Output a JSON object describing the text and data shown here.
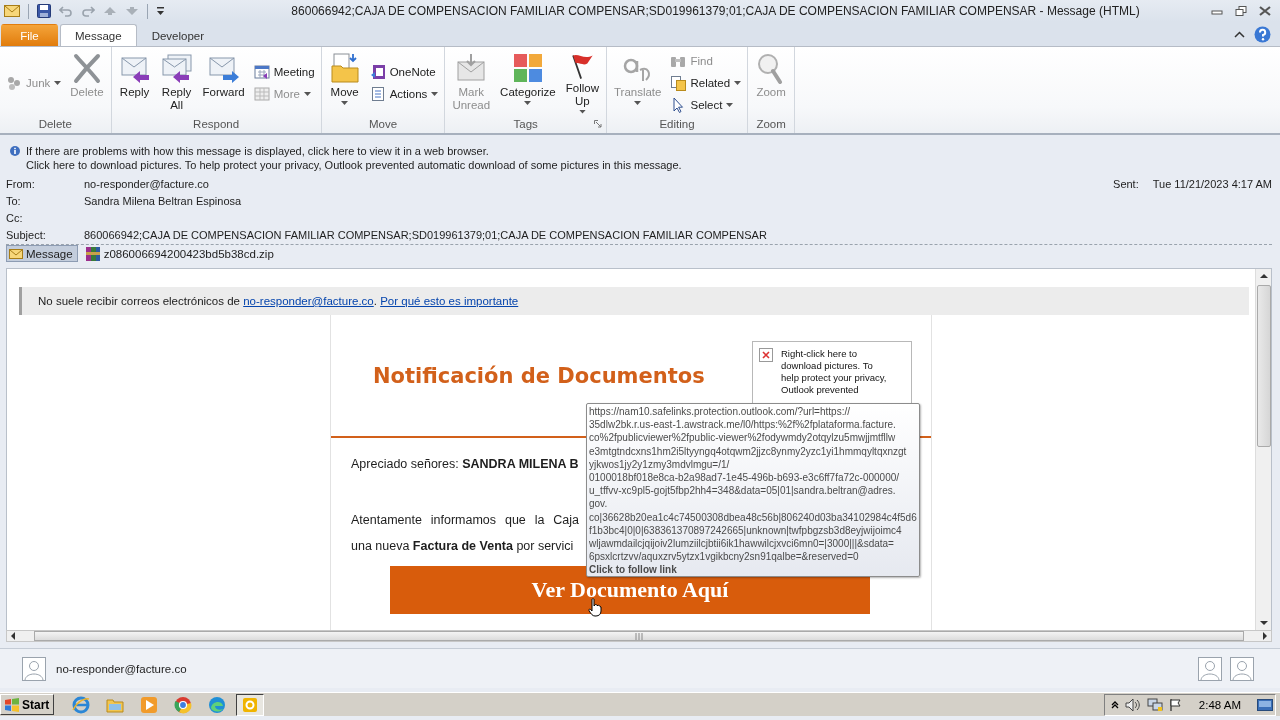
{
  "window": {
    "title": "860066942;CAJA DE COMPENSACION FAMILIAR COMPENSAR;SD019961379;01;CAJA DE COMPENSACION FAMILIAR COMPENSAR - Message (HTML)"
  },
  "tabs": [
    {
      "label": "File",
      "kind": "file",
      "selected": false
    },
    {
      "label": "Message",
      "kind": "tab",
      "selected": true
    },
    {
      "label": "Developer",
      "kind": "tab",
      "selected": false
    }
  ],
  "ribbon": {
    "groups": [
      {
        "label": "Delete",
        "columns": [
          [
            {
              "label": "Junk",
              "kind": "small",
              "disabled": true,
              "dropdown": true
            }
          ],
          [
            {
              "label": "Delete",
              "kind": "large",
              "disabled": true
            }
          ]
        ]
      },
      {
        "label": "Respond",
        "columns": [
          [
            {
              "label": "Reply",
              "kind": "large",
              "disabled": false
            }
          ],
          [
            {
              "label": "Reply All",
              "kind": "large",
              "disabled": false
            }
          ],
          [
            {
              "label": "Forward",
              "kind": "large",
              "disabled": false
            }
          ],
          [
            {
              "label": "Meeting",
              "kind": "small",
              "disabled": false
            },
            {
              "label": "More",
              "kind": "small",
              "disabled": true,
              "dropdown": true
            }
          ]
        ]
      },
      {
        "label": "Move",
        "columns": [
          [
            {
              "label": "Move",
              "kind": "large",
              "disabled": false,
              "dropdown": true
            }
          ],
          [
            {
              "label": "OneNote",
              "kind": "small",
              "disabled": false
            },
            {
              "label": "Actions",
              "kind": "small",
              "disabled": false,
              "dropdown": true
            }
          ]
        ]
      },
      {
        "label": "Tags",
        "launcher": true,
        "columns": [
          [
            {
              "label": "Mark Unread",
              "kind": "large",
              "disabled": true
            }
          ],
          [
            {
              "label": "Categorize",
              "kind": "large",
              "disabled": false,
              "dropdown": true
            }
          ],
          [
            {
              "label": "Follow Up",
              "kind": "large",
              "disabled": false,
              "dropdown": true
            }
          ]
        ]
      },
      {
        "label": "Editing",
        "columns": [
          [
            {
              "label": "Translate",
              "kind": "large",
              "disabled": true,
              "dropdown": true
            }
          ],
          [
            {
              "label": "Find",
              "kind": "small",
              "disabled": true
            },
            {
              "label": "Related",
              "kind": "small",
              "disabled": false,
              "dropdown": true
            },
            {
              "label": "Select",
              "kind": "small",
              "disabled": false,
              "dropdown": true
            }
          ]
        ]
      },
      {
        "label": "Zoom",
        "columns": [
          [
            {
              "label": "Zoom",
              "kind": "large",
              "disabled": true
            }
          ]
        ]
      }
    ]
  },
  "info_bar": [
    "If there are problems with how this message is displayed, click here to view it in a web browser.",
    "Click here to download pictures. To help protect your privacy, Outlook prevented automatic download of some pictures in this message."
  ],
  "headers": [
    {
      "label": "From:",
      "value": "no-responder@facture.co"
    },
    {
      "label": "To:",
      "value": "Sandra Milena Beltran Espinosa"
    },
    {
      "label": "Cc:"
    },
    {
      "label": "Subject:",
      "value": "860066942;CAJA DE COMPENSACION FAMILIAR COMPENSAR;SD019961379;01;CAJA DE COMPENSACION FAMILIAR COMPENSAR"
    }
  ],
  "sent": {
    "label": "Sent:",
    "value": "Tue 11/21/2023 4:17 AM"
  },
  "attachments": [
    {
      "label": "Message",
      "kind": "message",
      "selected": true
    },
    {
      "label": "z086006694200423bd5b38cd.zip",
      "kind": "zip",
      "selected": false
    }
  ],
  "banner": {
    "text": "No suele recibir correos electrónicos de",
    "sender_link": "no-responder@facture.co",
    "separator": ".",
    "info_link": "Por qué esto es importante"
  },
  "email": {
    "title": "Notificación de Documentos",
    "image_placeholder": [
      "Right-click here to",
      "download pictures.  To",
      "help protect your privacy,",
      "Outlook prevented"
    ],
    "greeting": "Apreciado señores: **SANDRA MILENA B**",
    "paragraph": [
      "Atentamente informamos que la Caja",
      "una nueva **Factura de Venta** por servici"
    ],
    "button": "Ver Documento Aquí"
  },
  "tooltip": {
    "lines": [
      "https://nam10.safelinks.protection.outlook.com/?url=https://",
      "35dlw2bk.r.us-east-1.awstrack.me/l0/https:%2f%2fplataforma.facture.",
      "co%2fpublicviewer%2fpublic-viewer%2fodywmdy2otqylzu5mwjjmtfllw",
      "e3mtgtndcxns1hm2i5ltyyngq4otqwm2jjzc8ynmy2yzc1yi1hmmqyltqxnzgt",
      "yjkwos1jy2y1zmy3mdvlmgu=/1/",
      "0100018bf018e8ca-b2a98ad7-1e45-496b-b693-e3c6ff7fa72c-000000/",
      "u_tffvv-xc9pl5-gojt5fbp2hh4=348&data=05|01|sandra.beltran@adres.",
      "gov.",
      "co|36628b20ea1c4c74500308dbea48c56b|806240d03ba34102984c4f5d6",
      "f1b3bc4|0|0|638361370897242665|unknown|twfpbgzsb3d8eyjwijoimc4",
      "wljawmdailcjqijoiv2lumziilcjbtii6ik1hawwilcjxvci6mn0=|3000|||&sdata=",
      "6psxlcrtzvv/aquxzrv5ytzx1vgikbcny2sn91qalbe=&reserved=0"
    ],
    "action": "Click to follow link"
  },
  "people_pane": {
    "sender": "no-responder@facture.co"
  },
  "taskbar": {
    "start": "Start",
    "time": "2:48 AM"
  }
}
